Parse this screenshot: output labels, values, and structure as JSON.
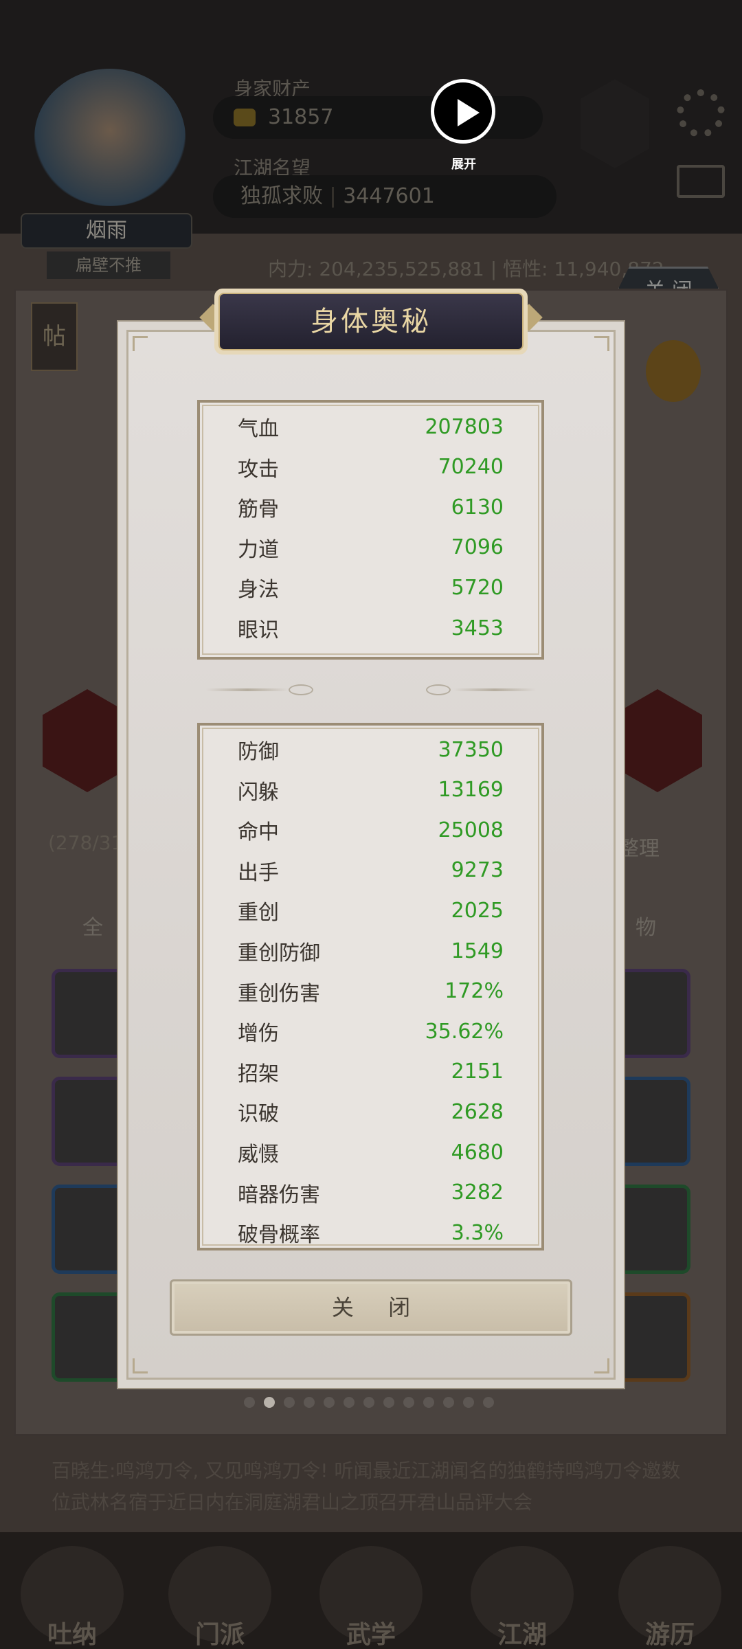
{
  "background": {
    "player_name": "烟雨",
    "player_title": "扁壁不推",
    "wealth_label": "身家财产",
    "wealth_value": "31857",
    "fame_label": "江湖名望",
    "fame_prefix": "独孤求败",
    "fame_value": "3447601",
    "power_line": "内力: 204,235,525,881  |  悟性: 11,940,872",
    "close_label": "关 闭",
    "sidebar_tab": "帖",
    "inventory_count": "(278/31",
    "sort_label": "整理",
    "filter_all": "全",
    "filter_items": "物",
    "ticker": "百晓生:鸣鸿刀令, 又见鸣鸿刀令! 听闻最近江湖闻名的独鹤持鸣鸿刀令邀数位武林名宿于近日内在洞庭湖君山之顶召开君山品评大会",
    "nav": [
      "吐纳",
      "门派",
      "武学",
      "江湖",
      "游历"
    ]
  },
  "video_overlay": {
    "expand_label": "展开"
  },
  "modal": {
    "title": "身体奥秘",
    "primary_stats": [
      {
        "label": "气血",
        "value": "207803"
      },
      {
        "label": "攻击",
        "value": "70240"
      },
      {
        "label": "筋骨",
        "value": "6130"
      },
      {
        "label": "力道",
        "value": "7096"
      },
      {
        "label": "身法",
        "value": "5720"
      },
      {
        "label": "眼识",
        "value": "3453"
      }
    ],
    "secondary_stats": [
      {
        "label": "防御",
        "value": "37350"
      },
      {
        "label": "闪躲",
        "value": "13169"
      },
      {
        "label": "命中",
        "value": "25008"
      },
      {
        "label": "出手",
        "value": "9273"
      },
      {
        "label": "重创",
        "value": "2025"
      },
      {
        "label": "重创防御",
        "value": "1549"
      },
      {
        "label": "重创伤害",
        "value": "172%"
      },
      {
        "label": "增伤",
        "value": "35.62%"
      },
      {
        "label": "招架",
        "value": "2151"
      },
      {
        "label": "识破",
        "value": "2628"
      },
      {
        "label": "威慑",
        "value": "4680"
      },
      {
        "label": "暗器伤害",
        "value": "3282"
      },
      {
        "label": "破骨概率",
        "value": "3.3%"
      }
    ],
    "close_label": "关 闭"
  },
  "pager": {
    "total": 13,
    "active": 1
  },
  "colors": {
    "stat_value": "#2f9a24",
    "title_text": "#e9d6a4"
  }
}
